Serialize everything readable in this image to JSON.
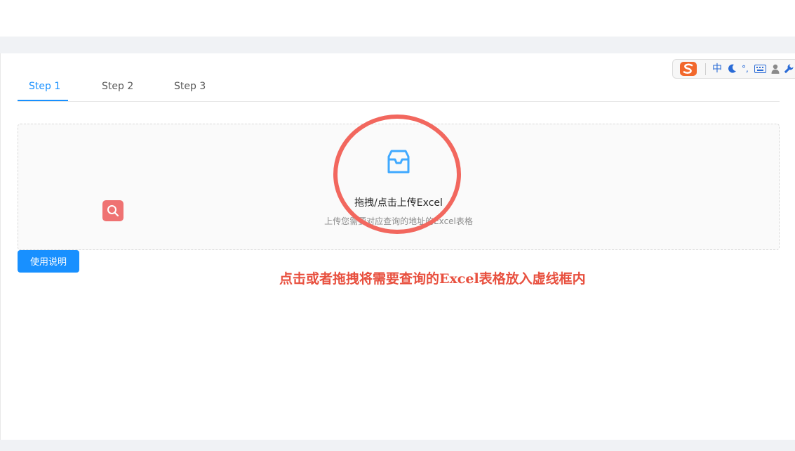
{
  "tabs": [
    {
      "label": "Step 1",
      "active": true
    },
    {
      "label": "Step 2",
      "active": false
    },
    {
      "label": "Step 3",
      "active": false
    }
  ],
  "upload": {
    "title": "拖拽/点击上传Excel",
    "hint": "上传您需要对应查询的地址的Excel表格",
    "icon": "inbox-icon"
  },
  "help_button": {
    "label": "使用说明"
  },
  "annotation": {
    "text": "点击或者拖拽将需要查询的Excel表格放入虚线框内",
    "color": "#e8503f"
  },
  "ime_toolbar": {
    "mode_label": "中",
    "punctuation": "°,",
    "icons": [
      "sogou-logo-icon",
      "moon-icon",
      "keyboard-icon",
      "user-icon",
      "wrench-icon"
    ]
  },
  "colors": {
    "primary": "#1890ff",
    "annotation": "#f2675e",
    "search_button": "#ef7272"
  }
}
